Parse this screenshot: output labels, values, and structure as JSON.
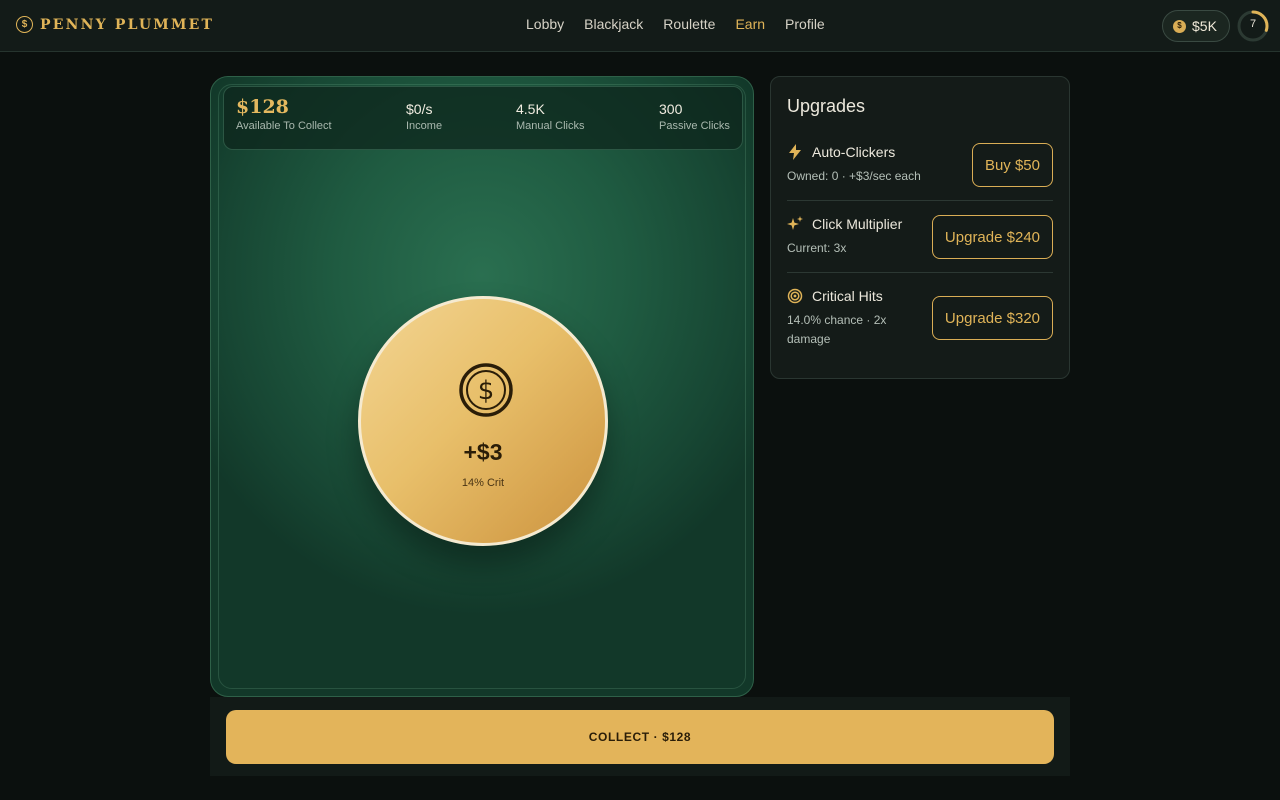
{
  "header": {
    "brand": "PENNY PLUMMET",
    "brand_icon": "dollar-coin-icon",
    "nav": [
      {
        "label": "Lobby",
        "active": false
      },
      {
        "label": "Blackjack",
        "active": false
      },
      {
        "label": "Roulette",
        "active": false
      },
      {
        "label": "Earn",
        "active": true
      },
      {
        "label": "Profile",
        "active": false
      }
    ],
    "balance": "$5K",
    "level": "7",
    "level_progress": 0.3
  },
  "stats": {
    "available": {
      "value": "$128",
      "label": "Available To Collect"
    },
    "income": {
      "value": "$0/s",
      "label": "Income"
    },
    "manual_clicks": {
      "value": "4.5K",
      "label": "Manual Clicks"
    },
    "passive_clicks": {
      "value": "300",
      "label": "Passive Clicks"
    }
  },
  "coin": {
    "amount": "+$3",
    "crit": "14% Crit",
    "icon": "dollar-circle-icon"
  },
  "upgrades": {
    "title": "Upgrades",
    "items": [
      {
        "name": "Auto-Clickers",
        "desc": "Owned: 0 · +$3/sec each",
        "button": "Buy $50",
        "icon": "lightning-icon"
      },
      {
        "name": "Click Multiplier",
        "desc": "Current: 3x",
        "button": "Upgrade $240",
        "icon": "sparkle-icon"
      },
      {
        "name": "Critical Hits",
        "desc": "14.0% chance · 2x damage",
        "button": "Upgrade $320",
        "icon": "target-icon"
      }
    ]
  },
  "collect": {
    "label": "COLLECT · $128"
  },
  "colors": {
    "accent_gold": "#e0b458",
    "felt_green": "#1f5b41",
    "background": "#0b100e"
  }
}
